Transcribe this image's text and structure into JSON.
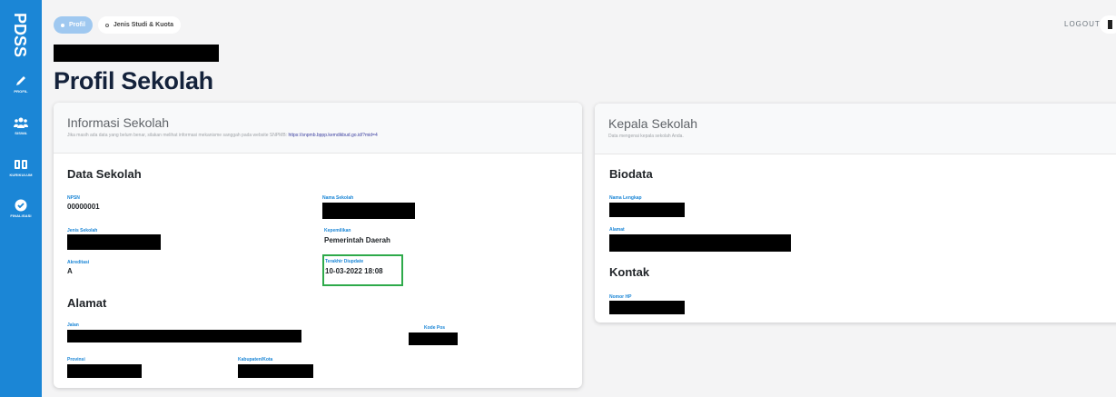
{
  "sidebar": {
    "brand": "PDSS",
    "items": [
      {
        "label": "PROFIL",
        "icon": "pencil-icon"
      },
      {
        "label": "SISWA",
        "icon": "users-icon"
      },
      {
        "label": "KURIKULUM",
        "icon": "book-icon"
      },
      {
        "label": "FINALISASI",
        "icon": "check-circle-icon"
      }
    ]
  },
  "tabs": [
    {
      "label": "Profil",
      "active": true
    },
    {
      "label": "Jenis Studi & Kuota",
      "active": false
    }
  ],
  "header": {
    "logout": "LOGOUT"
  },
  "page": {
    "title": "Profil Sekolah"
  },
  "info_card": {
    "title": "Informasi Sekolah",
    "subtitle": "Jika masih ada data yang belum benar, silakan melihat informasi mekanisme sanggah pada website SNPMB: ",
    "link": "https://snpmb.bppp.kemdikbud.go.id/?mid=4",
    "data_section": "Data Sekolah",
    "npsn_label": "NPSN",
    "npsn_value": "00000001",
    "nama_label": "Nama Sekolah",
    "jenis_label": "Jenis Sekolah",
    "kepemilikan_label": "Kepemilikan",
    "kepemilikan_value": "Pemerintah Daerah",
    "akreditasi_label": "Akreditasi",
    "akreditasi_value": "A",
    "update_label": "Terakhir Diupdate",
    "update_value": "10-03-2022 18:08",
    "alamat_section": "Alamat",
    "jalan_label": "Jalan",
    "kodepos_label": "Kode Pos",
    "provinsi_label": "Provinsi",
    "kabupaten_label": "Kabupaten/Kota"
  },
  "kepala_card": {
    "title": "Kepala Sekolah",
    "subtitle": "Data mengenai kepala sekolah Anda.",
    "biodata_section": "Biodata",
    "nama_label": "Nama Lengkap",
    "alamat_label": "Alamat",
    "kontak_section": "Kontak",
    "hp_label": "Nomor HP"
  },
  "colors": {
    "sidebar": "#1b86d6",
    "accent": "#1b86d6",
    "highlight": "#2eaa4a",
    "title": "#14223b"
  }
}
